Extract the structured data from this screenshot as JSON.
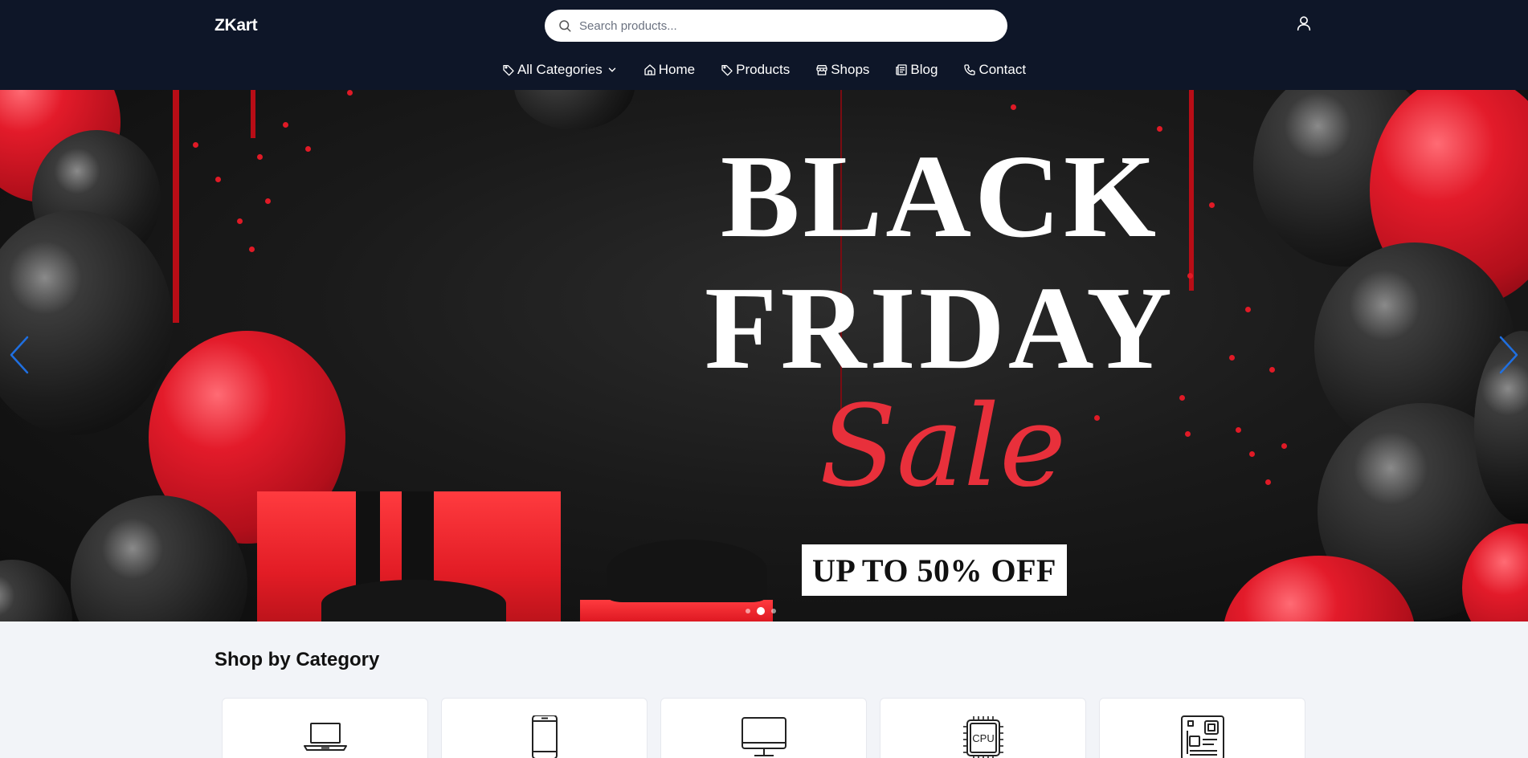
{
  "brand": {
    "name": "ZKart"
  },
  "search": {
    "placeholder": "Search products..."
  },
  "nav": {
    "items": [
      {
        "label": "All Categories",
        "icon": "tag-icon",
        "has_dropdown": true
      },
      {
        "label": "Home",
        "icon": "home-icon"
      },
      {
        "label": "Products",
        "icon": "tag-icon"
      },
      {
        "label": "Shops",
        "icon": "store-icon"
      },
      {
        "label": "Blog",
        "icon": "newspaper-icon"
      },
      {
        "label": "Contact",
        "icon": "phone-icon"
      }
    ]
  },
  "hero": {
    "line1": "BLACK",
    "line2": "FRIDAY",
    "line3": "Sale",
    "badge": "UP TO 50% OFF",
    "slide_count": 3,
    "active_slide": 2
  },
  "categories": {
    "title": "Shop by Category",
    "items": [
      {
        "icon": "laptop-icon"
      },
      {
        "icon": "smartphone-icon"
      },
      {
        "icon": "monitor-icon"
      },
      {
        "icon": "cpu-icon"
      },
      {
        "icon": "motherboard-icon"
      }
    ],
    "cpu_icon_text": "CPU"
  },
  "colors": {
    "header_bg": "#0e1628",
    "page_bg": "#f2f4f8",
    "sale_red": "#e8303b",
    "arrow_blue": "#1f6fe0"
  }
}
